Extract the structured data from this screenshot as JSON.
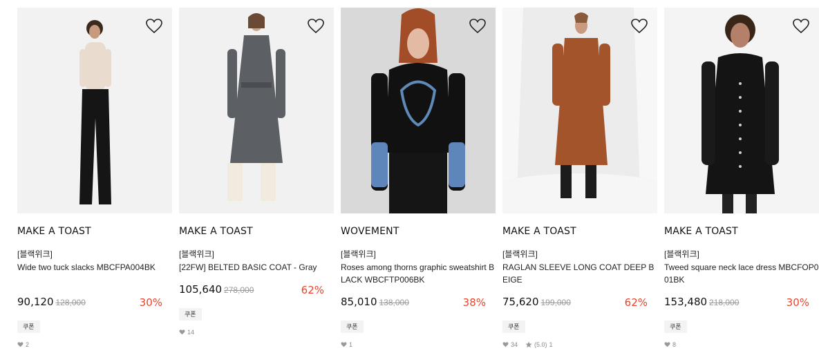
{
  "products": [
    {
      "brand": "MAKE A TOAST",
      "tag": "[블랙위크]",
      "name": "Wide two tuck slacks MBCFPA004BK",
      "price": "90,120",
      "original_price": "128,000",
      "discount": "30%",
      "coupon": "쿠폰",
      "likes": "2",
      "rating": "",
      "reviews": ""
    },
    {
      "brand": "MAKE A TOAST",
      "tag": "[블랙위크]",
      "name": "[22FW] BELTED BASIC COAT - Gray",
      "price": "105,640",
      "original_price": "278,000",
      "discount": "62%",
      "coupon": "쿠폰",
      "likes": "14",
      "rating": "",
      "reviews": ""
    },
    {
      "brand": "WOVEMENT",
      "tag": "[블랙위크]",
      "name": "Roses among thorns graphic sweatshirt BLACK WBCFTP006BK",
      "price": "85,010",
      "original_price": "138,000",
      "discount": "38%",
      "coupon": "쿠폰",
      "likes": "1",
      "rating": "",
      "reviews": ""
    },
    {
      "brand": "MAKE A TOAST",
      "tag": "[블랙위크]",
      "name": "RAGLAN SLEEVE LONG COAT DEEP BEIGE",
      "price": "75,620",
      "original_price": "199,000",
      "discount": "62%",
      "coupon": "쿠폰",
      "likes": "34",
      "rating": "(5.0)",
      "reviews": "1"
    },
    {
      "brand": "MAKE A TOAST",
      "tag": "[블랙위크]",
      "name": "Tweed square neck lace dress MBCFOP001BK",
      "price": "153,480",
      "original_price": "218,000",
      "discount": "30%",
      "coupon": "쿠폰",
      "likes": "8",
      "rating": "",
      "reviews": ""
    }
  ],
  "colors": {
    "discount": "#e8442c",
    "strike": "#999999",
    "coupon_bg": "#f3f3f3"
  },
  "icons": {
    "wishlist": "heart-outline-icon",
    "likes": "heart-filled-icon",
    "rating": "star-icon"
  }
}
